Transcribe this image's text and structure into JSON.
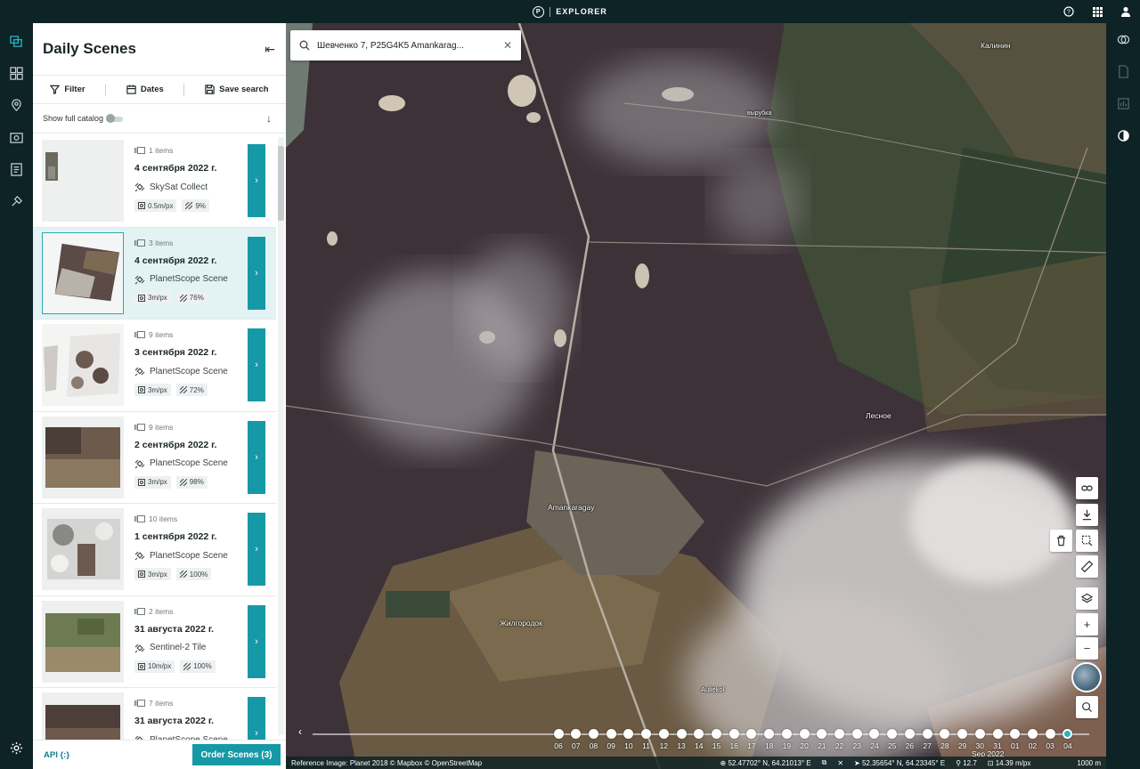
{
  "app": {
    "logo": "P",
    "name": "EXPLORER"
  },
  "top_icons": [
    "help-icon",
    "apps-grid-icon",
    "user-icon"
  ],
  "panel": {
    "title": "Daily Scenes",
    "toolbar": {
      "filter": "Filter",
      "dates": "Dates",
      "save": "Save search"
    },
    "catalog_toggle": "Show full catalog",
    "footer": {
      "api": "API {:}",
      "order": "Order Scenes (3)"
    }
  },
  "scenes": [
    {
      "count": "1 items",
      "date": "4 сентября 2022 г.",
      "type": "SkySat Collect",
      "res": "0.5m/px",
      "cloud": "9%"
    },
    {
      "count": "3 items",
      "date": "4 сентября 2022 г.",
      "type": "PlanetScope Scene",
      "res": "3m/px",
      "cloud": "76%"
    },
    {
      "count": "9 items",
      "date": "3 сентября 2022 г.",
      "type": "PlanetScope Scene",
      "res": "3m/px",
      "cloud": "72%"
    },
    {
      "count": "9 items",
      "date": "2 сентября 2022 г.",
      "type": "PlanetScope Scene",
      "res": "3m/px",
      "cloud": "98%"
    },
    {
      "count": "10 items",
      "date": "1 сентября 2022 г.",
      "type": "PlanetScope Scene",
      "res": "3m/px",
      "cloud": "100%"
    },
    {
      "count": "2 items",
      "date": "31 августа 2022 г.",
      "type": "Sentinel-2 Tile",
      "res": "10m/px",
      "cloud": "100%"
    },
    {
      "count": "7 items",
      "date": "31 августа 2022 г.",
      "type": "PlanetScope Scene",
      "res": "",
      "cloud": ""
    }
  ],
  "search": {
    "value": "Шевченко 7, P25G4K5 Amankarag..."
  },
  "map_labels": {
    "kalinin": "Калинин",
    "vyrubka": "вырубка",
    "lesnoe": "Лесное",
    "amankaragay": "Amankaragay",
    "zhilgorodok": "Жилгородок",
    "aulieкol": "Auliekol"
  },
  "timeline": {
    "days": [
      "06",
      "07",
      "08",
      "09",
      "10",
      "11",
      "12",
      "13",
      "14",
      "15",
      "16",
      "17",
      "18",
      "19",
      "20",
      "21",
      "22",
      "23",
      "24",
      "25",
      "26",
      "27",
      "28",
      "29",
      "30",
      "31",
      "01",
      "02",
      "03",
      "04"
    ],
    "month": "Sep 2022",
    "selected": "04"
  },
  "status": {
    "attribution": "Reference Image: Planet 2018 © Mapbox © OpenStreetMap",
    "coord1": "52.47702° N, 64.21013° E",
    "coord2": "52.35654° N, 64.23345° E",
    "zoom": "12.7",
    "scale_res": "14.39 m/px",
    "scale_bar": "1000 m"
  },
  "colors": {
    "accent": "#1699a6",
    "rail": "#0e2326"
  }
}
